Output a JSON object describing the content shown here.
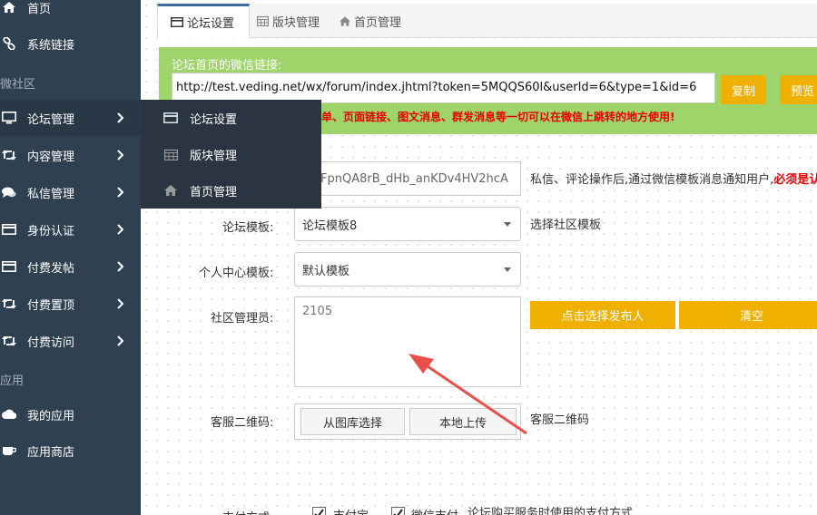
{
  "sidebar": {
    "items": [
      {
        "label": "首页",
        "icon": "home-icon"
      },
      {
        "label": "系统链接",
        "icon": "link-icon"
      },
      {
        "label": "论坛管理",
        "icon": "monitor-icon"
      },
      {
        "label": "内容管理",
        "icon": "retweet-icon"
      },
      {
        "label": "私信管理",
        "icon": "comments-icon"
      },
      {
        "label": "身份认证",
        "icon": "card-icon"
      },
      {
        "label": "付费发帖",
        "icon": "card-icon"
      },
      {
        "label": "付费置顶",
        "icon": "retweet-icon"
      },
      {
        "label": "付费访问",
        "icon": "retweet-icon"
      },
      {
        "label": "我的应用",
        "icon": "cloud-icon"
      },
      {
        "label": "应用商店",
        "icon": "coffee-icon"
      }
    ],
    "sections": [
      "微社区",
      "应用"
    ]
  },
  "flyout": {
    "items": [
      {
        "label": "论坛设置",
        "icon": "card-icon"
      },
      {
        "label": "版块管理",
        "icon": "calendar-icon"
      },
      {
        "label": "首页管理",
        "icon": "home-icon"
      }
    ]
  },
  "tabs": [
    {
      "label": "论坛设置",
      "icon": "card-icon"
    },
    {
      "label": "版块管理",
      "icon": "calendar-icon"
    },
    {
      "label": "首页管理",
      "icon": "home-icon"
    }
  ],
  "wechat_link": {
    "label": "论坛首页的微信链接:",
    "url": "http://test.veding.net/wx/forum/index.jhtml?token=5MQQS60l&userId=6&type=1&id=6",
    "copy_label": "复制",
    "preview_label": "预览",
    "warning": "单、页面链接、图文消息、群发消息等一切可以在微信上跳转的地方使用!"
  },
  "template_msg": {
    "value": "FpnQA8rB_dHb_anKDv4HV2hcA",
    "help_prefix": "私信、评论操作后,通过微信模板消息通知用户,",
    "help_bold": "必须是认"
  },
  "forum_template": {
    "label": "论坛模板:",
    "value": "论坛模板8",
    "help": "选择社区模板"
  },
  "personal_template": {
    "label": "个人中心模板:",
    "value": "默认模板"
  },
  "admin": {
    "label": "社区管理员:",
    "value": "2105",
    "pick_label": "点击选择发布人",
    "clear_label": "清空"
  },
  "qrcode": {
    "label": "客服二维码:",
    "gallery_label": "从图库选择",
    "upload_label": "本地上传",
    "help": "客服二维码"
  },
  "payment": {
    "label": "支付方式:",
    "opt1": "支付宝",
    "opt2": "微信支付",
    "help": "论坛购买服务时使用的支付方式"
  },
  "colors": {
    "sidebar": "#2f4050",
    "accent": "#f0b000",
    "green": "#9ed46a",
    "annotation": "#e8504a"
  }
}
